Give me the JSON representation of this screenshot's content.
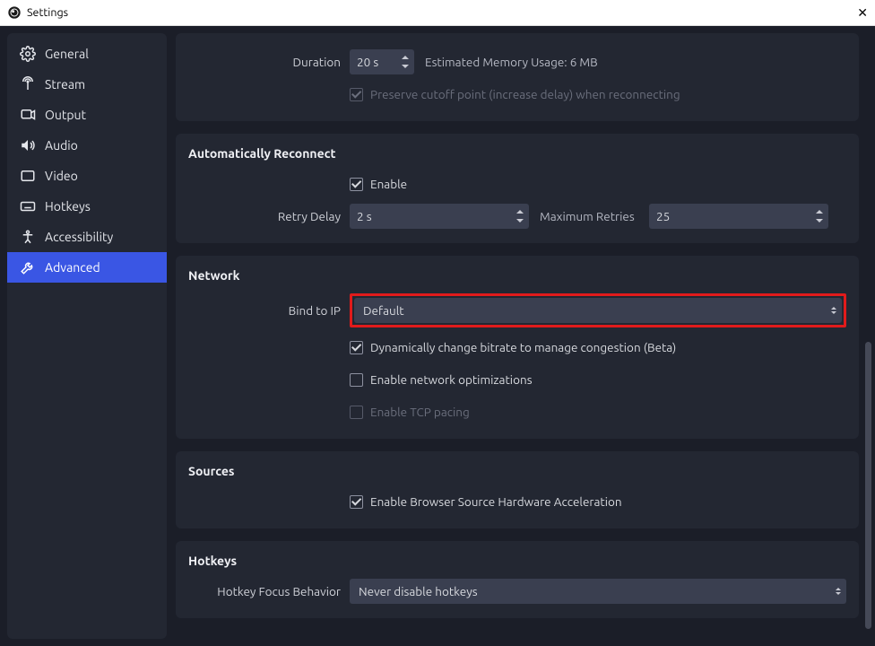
{
  "window": {
    "title": "Settings"
  },
  "sidebar": {
    "items": [
      {
        "label": "General"
      },
      {
        "label": "Stream"
      },
      {
        "label": "Output"
      },
      {
        "label": "Audio"
      },
      {
        "label": "Video"
      },
      {
        "label": "Hotkeys"
      },
      {
        "label": "Accessibility"
      },
      {
        "label": "Advanced"
      }
    ]
  },
  "delay": {
    "duration_label": "Duration",
    "duration_value": "20 s",
    "estimate": "Estimated Memory Usage: 6 MB",
    "preserve_label": "Preserve cutoff point (increase delay) when reconnecting"
  },
  "reconnect": {
    "title": "Automatically Reconnect",
    "enable_label": "Enable",
    "retry_delay_label": "Retry Delay",
    "retry_delay_value": "2 s",
    "max_retries_label": "Maximum Retries",
    "max_retries_value": "25"
  },
  "network": {
    "title": "Network",
    "bind_label": "Bind to IP",
    "bind_value": "Default",
    "dyn_bitrate_label": "Dynamically change bitrate to manage congestion (Beta)",
    "opt_label": "Enable network optimizations",
    "tcp_label": "Enable TCP pacing"
  },
  "sources": {
    "title": "Sources",
    "browser_accel_label": "Enable Browser Source Hardware Acceleration"
  },
  "hotkeys": {
    "title": "Hotkeys",
    "focus_label": "Hotkey Focus Behavior",
    "focus_value": "Never disable hotkeys"
  }
}
